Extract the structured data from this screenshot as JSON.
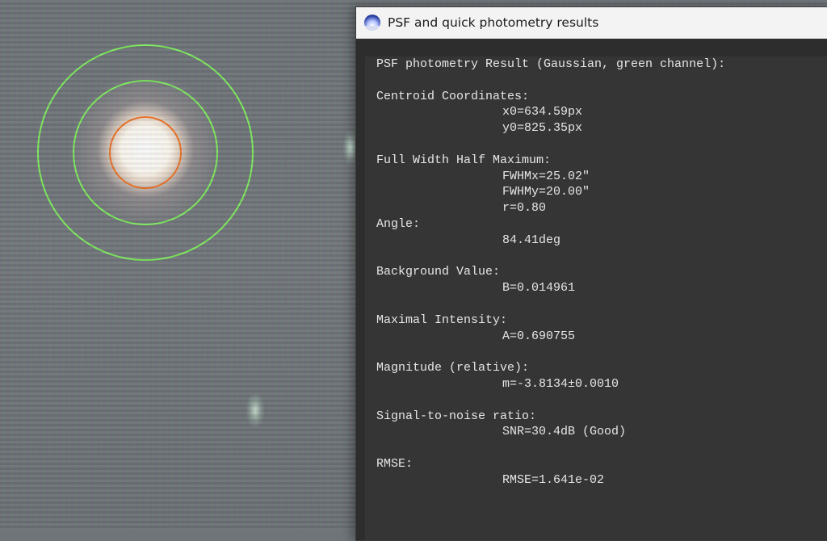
{
  "dialog": {
    "title": "PSF and quick photometry results",
    "icon": "app-icon"
  },
  "results": {
    "header": "PSF photometry Result (Gaussian, green channel):",
    "centroid_label": "Centroid Coordinates:",
    "x0": "x0=634.59px",
    "y0": "y0=825.35px",
    "fwhm_label": "Full Width Half Maximum:",
    "fwhmx": "FWHMx=25.02\"",
    "fwhmy": "FWHMy=20.00\"",
    "ratio": "r=0.80",
    "angle_label": "Angle:",
    "angle": "84.41deg",
    "background_label": "Background Value:",
    "background": "B=0.014961",
    "intensity_label": "Maximal Intensity:",
    "intensity": "A=0.690755",
    "magnitude_label": "Magnitude (relative):",
    "magnitude": "m=-3.8134±0.0010",
    "snr_label": "Signal-to-noise ratio:",
    "snr": "SNR=30.4dB (Good)",
    "rmse_label": "RMSE:",
    "rmse": "RMSE=1.641e-02"
  },
  "colors": {
    "aperture_inner": "#f07020",
    "annulus": "#7ef05a"
  }
}
